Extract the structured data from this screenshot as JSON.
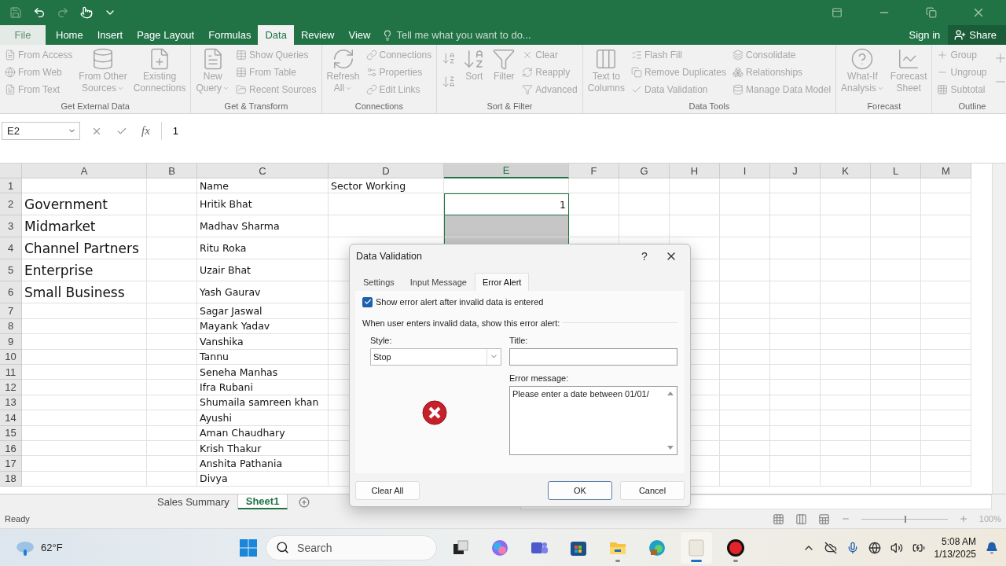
{
  "ribbon_tabs": [
    {
      "label": "File",
      "selected": false,
      "kind": "file"
    },
    {
      "label": "Home",
      "selected": false,
      "kind": "tab"
    },
    {
      "label": "Insert",
      "selected": false,
      "kind": "tab"
    },
    {
      "label": "Page Layout",
      "selected": false,
      "kind": "tab"
    },
    {
      "label": "Formulas",
      "selected": false,
      "kind": "tab"
    },
    {
      "label": "Data",
      "selected": true,
      "kind": "tab"
    },
    {
      "label": "Review",
      "selected": false,
      "kind": "tab"
    },
    {
      "label": "View",
      "selected": false,
      "kind": "tab"
    }
  ],
  "tell_me": {
    "placeholder": "Tell me what you want to do..."
  },
  "account": {
    "sign_in": "Sign in",
    "share": "Share"
  },
  "ribbon": {
    "disabled": true,
    "groups": [
      {
        "title": "Get External Data",
        "items": [
          {
            "kind": "stack",
            "entries": [
              {
                "label": "From Access"
              },
              {
                "label": "From Web"
              },
              {
                "label": "From Text"
              }
            ]
          },
          {
            "kind": "large",
            "lines": [
              "From Other",
              "Sources"
            ],
            "dropdown": true
          },
          {
            "kind": "large",
            "lines": [
              "Existing",
              "Connections"
            ],
            "dropdown": false
          }
        ]
      },
      {
        "title": "Get & Transform",
        "items": [
          {
            "kind": "large",
            "lines": [
              "New",
              "Query"
            ],
            "dropdown": true
          },
          {
            "kind": "stack",
            "entries": [
              {
                "label": "Show Queries"
              },
              {
                "label": "From Table"
              },
              {
                "label": "Recent Sources"
              }
            ]
          }
        ]
      },
      {
        "title": "Connections",
        "items": [
          {
            "kind": "large",
            "lines": [
              "Refresh",
              "All"
            ],
            "dropdown": true
          },
          {
            "kind": "stack",
            "entries": [
              {
                "label": "Connections"
              },
              {
                "label": "Properties"
              },
              {
                "label": "Edit Links"
              }
            ]
          }
        ]
      },
      {
        "title": "Sort & Filter",
        "items": [
          {
            "kind": "icons"
          },
          {
            "kind": "large",
            "lines": [
              "Sort"
            ],
            "dropdown": false
          },
          {
            "kind": "large",
            "lines": [
              "Filter"
            ],
            "dropdown": false
          },
          {
            "kind": "stack",
            "entries": [
              {
                "label": "Clear"
              },
              {
                "label": "Reapply"
              },
              {
                "label": "Advanced"
              }
            ]
          }
        ]
      },
      {
        "title": "Data Tools",
        "items": [
          {
            "kind": "large",
            "lines": [
              "Text to",
              "Columns"
            ],
            "dropdown": false
          },
          {
            "kind": "stack",
            "entries": [
              {
                "label": "Flash Fill"
              },
              {
                "label": "Remove Duplicates"
              },
              {
                "label": "Data Validation"
              }
            ]
          },
          {
            "kind": "stack",
            "entries": [
              {
                "label": "Consolidate"
              },
              {
                "label": "Relationships"
              },
              {
                "label": "Manage Data Model"
              }
            ]
          }
        ]
      },
      {
        "title": "Forecast",
        "items": [
          {
            "kind": "large",
            "lines": [
              "What-If",
              "Analysis"
            ],
            "dropdown": true
          },
          {
            "kind": "large",
            "lines": [
              "Forecast",
              "Sheet"
            ],
            "dropdown": false
          }
        ]
      },
      {
        "title": "Outline",
        "items": [
          {
            "kind": "stack",
            "entries": [
              {
                "label": "Group"
              },
              {
                "label": "Ungroup"
              },
              {
                "label": "Subtotal"
              }
            ]
          },
          {
            "kind": "icons"
          }
        ]
      }
    ]
  },
  "formula_bar": {
    "name_box": "E2",
    "fx": "fx",
    "value": "1"
  },
  "columns": [
    {
      "label": "A",
      "selected": false
    },
    {
      "label": "B",
      "selected": false
    },
    {
      "label": "C",
      "selected": false
    },
    {
      "label": "D",
      "selected": false
    },
    {
      "label": "E",
      "selected": true
    },
    {
      "label": "F",
      "selected": false
    },
    {
      "label": "G",
      "selected": false
    },
    {
      "label": "H",
      "selected": false
    },
    {
      "label": "I",
      "selected": false
    },
    {
      "label": "J",
      "selected": false
    },
    {
      "label": "K",
      "selected": false
    },
    {
      "label": "L",
      "selected": false
    },
    {
      "label": "M",
      "selected": false
    }
  ],
  "rows": [
    {
      "number": "1",
      "kind": "normal",
      "c": "Name",
      "d": "Sector Working",
      "e_active": false,
      "e_selected": false
    },
    {
      "number": "2",
      "kind": "tall",
      "a": "Government",
      "c": "Hritik Bhat",
      "e": "1",
      "e_active": true,
      "e_selected": true
    },
    {
      "number": "3",
      "kind": "tall",
      "a": "Midmarket",
      "c": "Madhav Sharma",
      "e_active": false,
      "e_selected": true
    },
    {
      "number": "4",
      "kind": "tall",
      "a": "Channel Partners",
      "c": "Ritu Roka",
      "e_active": false,
      "e_selected": true
    },
    {
      "number": "5",
      "kind": "tall",
      "a": "Enterprise",
      "c": "Uzair Bhat"
    },
    {
      "number": "6",
      "kind": "tall",
      "a": "Small Business",
      "c": "Yash Gaurav"
    },
    {
      "number": "7",
      "kind": "normal",
      "c": "Sagar Jaswal"
    },
    {
      "number": "8",
      "kind": "normal",
      "c": "Mayank Yadav"
    },
    {
      "number": "9",
      "kind": "normal",
      "c": "Vanshika"
    },
    {
      "number": "10",
      "kind": "normal",
      "c": "Tannu"
    },
    {
      "number": "11",
      "kind": "normal",
      "c": "Seneha Manhas"
    },
    {
      "number": "12",
      "kind": "normal",
      "c": "Ifra Rubani"
    },
    {
      "number": "13",
      "kind": "normal",
      "c": "Shumaila samreen khan"
    },
    {
      "number": "14",
      "kind": "normal",
      "c": "Ayushi"
    },
    {
      "number": "15",
      "kind": "normal",
      "c": "Aman Chaudhary"
    },
    {
      "number": "16",
      "kind": "normal",
      "c": "Krish Thakur"
    },
    {
      "number": "17",
      "kind": "normal",
      "c": "Anshita Pathania"
    },
    {
      "number": "18",
      "kind": "normal",
      "c": "Divya"
    }
  ],
  "sheet_tabs": [
    {
      "label": "Sales Summary",
      "selected": false
    },
    {
      "label": "Sheet1",
      "selected": true
    }
  ],
  "status_bar": {
    "text": "Ready",
    "zoom": {
      "level": 0.5,
      "reading": "100%"
    }
  },
  "dialog": {
    "title": "Data Validation",
    "help": "?",
    "tabs": [
      {
        "label": "Settings",
        "selected": false
      },
      {
        "label": "Input Message",
        "selected": false
      },
      {
        "label": "Error Alert",
        "selected": true
      }
    ],
    "show_alert": {
      "label": "Show error alert after invalid data is entered",
      "checked": true
    },
    "section": "When user enters invalid data, show this error alert:",
    "style_label": "Style:",
    "style_value": "Stop",
    "title_label": "Title:",
    "message_label": "Error message:",
    "message_value": "Please enter a date between 01/01/",
    "buttons": [
      {
        "label": "Clear All",
        "kind": "left",
        "selected": false
      },
      {
        "label": "OK",
        "kind": "right",
        "selected": true
      },
      {
        "label": "Cancel",
        "kind": "right",
        "selected": false
      }
    ]
  },
  "taskbar": {
    "weather": "62°F",
    "search": {
      "placeholder": "Search"
    },
    "apps": [
      {
        "kind": "taskview",
        "active": false
      },
      {
        "kind": "copilot",
        "active": false
      },
      {
        "kind": "teams",
        "active": false
      },
      {
        "kind": "store",
        "active": false
      },
      {
        "kind": "explorer",
        "active": false
      },
      {
        "kind": "edge",
        "active": false
      },
      {
        "kind": "blank",
        "active": true
      },
      {
        "kind": "record",
        "active": false
      }
    ],
    "time": "5:08 AM",
    "date": "1/13/2025"
  }
}
